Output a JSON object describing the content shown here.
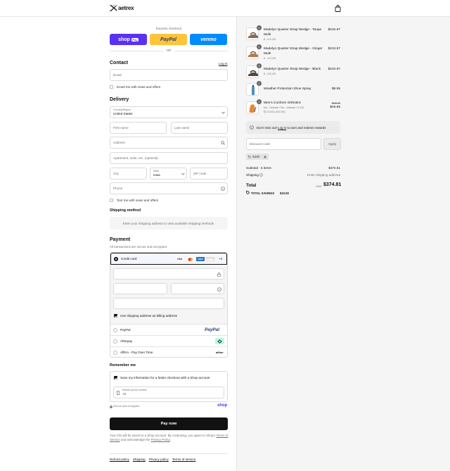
{
  "brand": {
    "name": "aetrex"
  },
  "express": {
    "label": "Express checkout",
    "shop_pay": "shop",
    "shop_pay_badge": "Pay",
    "paypal": "PayPal",
    "venmo": "venmo",
    "or": "OR"
  },
  "contact": {
    "title": "Contact",
    "login": "Log in",
    "email_placeholder": "Email",
    "email_news": "Email me with news and offers"
  },
  "delivery": {
    "title": "Delivery",
    "country_label": "Country/Region",
    "country_value": "United States",
    "first_name": "First name",
    "last_name": "Last name",
    "address": "Address",
    "apartment": "Apartment, suite, etc. (optional)",
    "city": "City",
    "state_label": "State",
    "state_value": "Iowa",
    "zip": "ZIP code",
    "phone": "Phone",
    "text_news": "Text me with news and offers"
  },
  "shipping_method": {
    "title": "Shipping method",
    "note": "Enter your shipping address to view available shipping methods."
  },
  "payment": {
    "title": "Payment",
    "subtitle": "All transactions are secure and encrypted.",
    "credit_card": "Credit card",
    "card_brands": [
      "VISA",
      "MC",
      "AMEX",
      "DISCOVER"
    ],
    "more_cards": "+4",
    "billing_same": "Use shipping address as billing address",
    "paypal": "PayPal",
    "paypal_logo": "PayPal",
    "afterpay": "Afterpay",
    "affirm": "Affirm - Pay Over Time",
    "affirm_logo": "affirm"
  },
  "remember": {
    "title": "Remember me",
    "save_info": "Save my information for a faster checkout with a Shop account",
    "phone_label": "Mobile phone number",
    "phone_value": "+1",
    "secure": "Secure and encrypted",
    "shop_logo": "shop"
  },
  "pay_now": "Pay now",
  "disclaimer": {
    "text1": "Your info will be saved to a Shop account. By continuing, you agree to Shop's",
    "tos": "Terms of Service",
    "text2": "and acknowledge the",
    "privacy": "Privacy Policy",
    "end": "."
  },
  "footer": [
    "Refund policy",
    "Shipping",
    "Privacy policy",
    "Terms of service"
  ],
  "cart": {
    "items": [
      {
        "qty": "1",
        "name": "Madelyn Quarter Strap Wedge - Taupe Multi",
        "variant": "6 - 6.5 US",
        "price": "$104.97"
      },
      {
        "qty": "1",
        "name": "Madelyn Quarter Strap Wedge - Ginger Multi",
        "variant": "6 - 6.5 US",
        "price": "$104.97"
      },
      {
        "qty": "1",
        "name": "Madelyn Quarter Strap Wedge - Black",
        "variant": "6 - 6.5 US",
        "price": "$104.97"
      },
      {
        "qty": "1",
        "name": "Weather Protection Shoe Spray",
        "variant": "",
        "price": "$9.95"
      },
      {
        "qty": "1",
        "name": "Men's Conform Orthotics",
        "variant": "No - Unisole / No - Unisole / S US",
        "discount": "GJ10 (-$10.00)",
        "old_price": "$59.95",
        "price": "$49.95"
      }
    ],
    "login_note_pre": "Don't miss out!",
    "login_note_link": "Log in",
    "login_note_post": "to earn and redeem rewards",
    "discount_placeholder": "Discount code",
    "apply": "Apply",
    "code_tag": "GJ10",
    "subtotal_label": "Subtotal · 5 items",
    "subtotal_value": "$374.81",
    "shipping_label": "Shipping",
    "shipping_value": "Enter shipping address",
    "total_label": "Total",
    "currency": "USD",
    "total_value": "$374.81",
    "savings_label": "TOTAL SAVINGS",
    "savings_value": "$10.00"
  }
}
